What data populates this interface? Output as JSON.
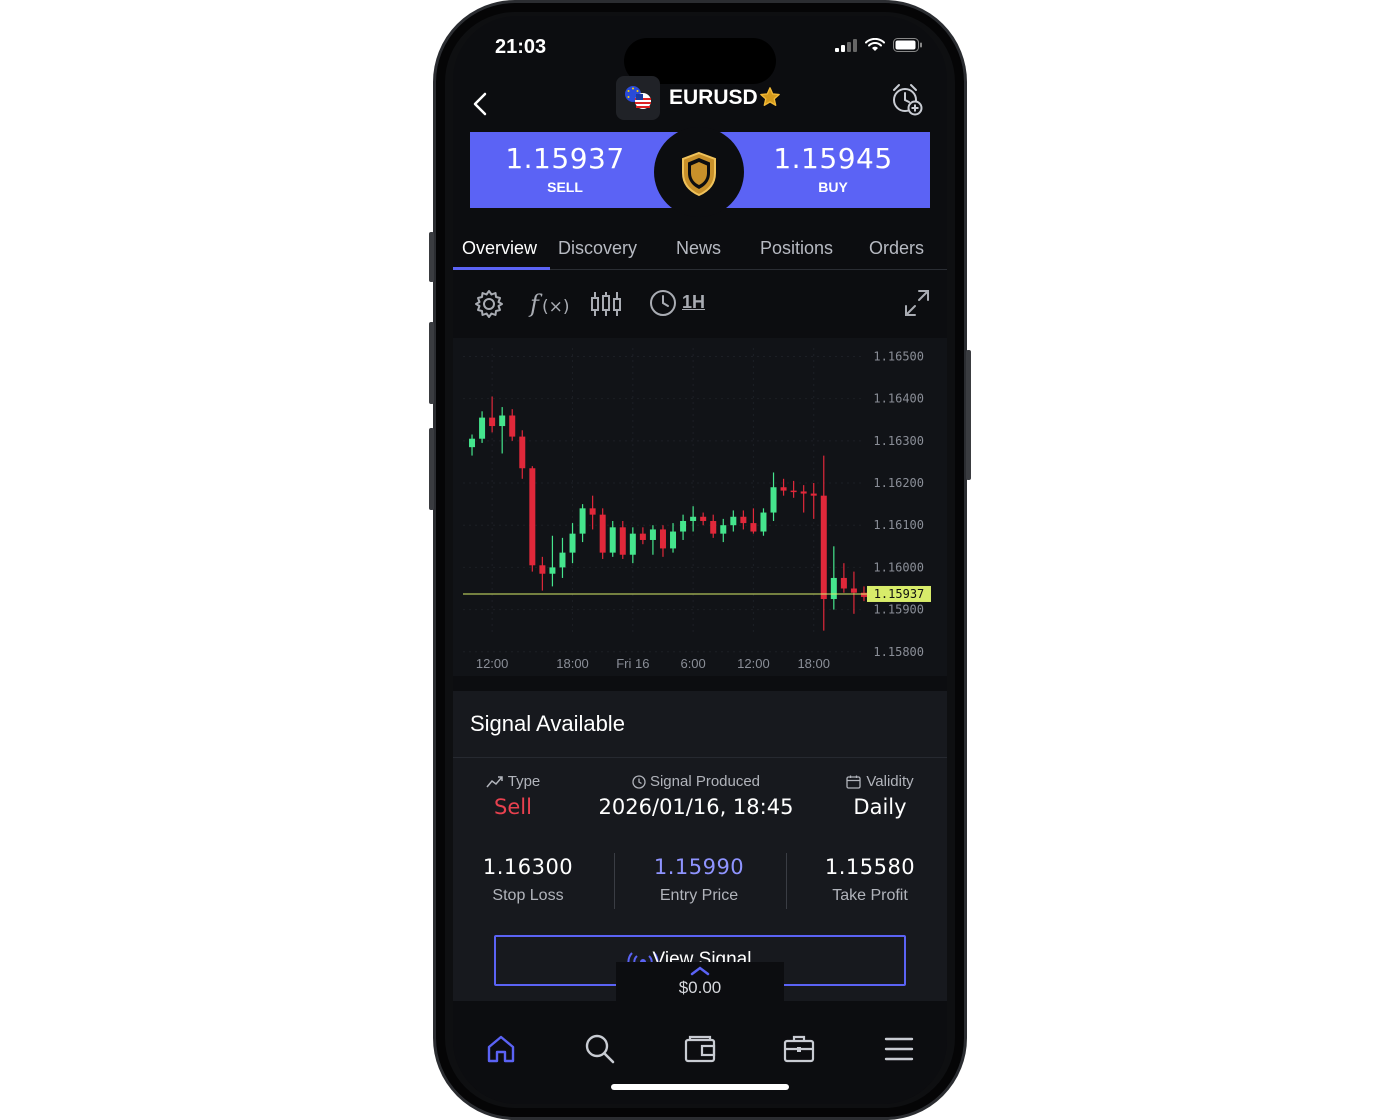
{
  "status_bar": {
    "time": "21:03"
  },
  "header": {
    "pair": "EURUSD"
  },
  "quote": {
    "sell_price": "1.15937",
    "sell_label": "SELL",
    "buy_price": "1.15945",
    "buy_label": "BUY"
  },
  "tabs": [
    {
      "label": "Overview",
      "active": true
    },
    {
      "label": "Discovery"
    },
    {
      "label": "News"
    },
    {
      "label": "Positions"
    },
    {
      "label": "Orders"
    }
  ],
  "toolbar": {
    "timeframe": "1H"
  },
  "chart_data": {
    "type": "candlestick",
    "y_ticks": [
      "1.16500",
      "1.16400",
      "1.16300",
      "1.16200",
      "1.16100",
      "1.16000",
      "1.15900",
      "1.15800"
    ],
    "x_ticks": [
      "12:00",
      "18:00",
      "Fri 16",
      "6:00",
      "12:00",
      "18:00"
    ],
    "ylim": [
      1.1579,
      1.1652
    ],
    "current_price": "1.15937",
    "colors": {
      "up": "#45e58d",
      "down": "#e0283a",
      "price_line": "#d8ec6a"
    },
    "candles": [
      {
        "o": 1.16285,
        "h": 1.16315,
        "l": 1.16265,
        "c": 1.16305
      },
      {
        "o": 1.16305,
        "h": 1.1637,
        "l": 1.16295,
        "c": 1.16355
      },
      {
        "o": 1.16355,
        "h": 1.16405,
        "l": 1.1632,
        "c": 1.16335
      },
      {
        "o": 1.16335,
        "h": 1.1638,
        "l": 1.1627,
        "c": 1.1636
      },
      {
        "o": 1.1636,
        "h": 1.16375,
        "l": 1.163,
        "c": 1.1631
      },
      {
        "o": 1.1631,
        "h": 1.16325,
        "l": 1.1621,
        "c": 1.16235
      },
      {
        "o": 1.16235,
        "h": 1.1624,
        "l": 1.1599,
        "c": 1.16005
      },
      {
        "o": 1.16005,
        "h": 1.16025,
        "l": 1.15945,
        "c": 1.15985
      },
      {
        "o": 1.15985,
        "h": 1.16075,
        "l": 1.15955,
        "c": 1.16
      },
      {
        "o": 1.16,
        "h": 1.1607,
        "l": 1.15975,
        "c": 1.16035
      },
      {
        "o": 1.16035,
        "h": 1.16105,
        "l": 1.1601,
        "c": 1.1608
      },
      {
        "o": 1.1608,
        "h": 1.1615,
        "l": 1.1606,
        "c": 1.1614
      },
      {
        "o": 1.1614,
        "h": 1.1617,
        "l": 1.1609,
        "c": 1.16125
      },
      {
        "o": 1.16125,
        "h": 1.1614,
        "l": 1.1602,
        "c": 1.16035
      },
      {
        "o": 1.16035,
        "h": 1.1611,
        "l": 1.16025,
        "c": 1.16095
      },
      {
        "o": 1.16095,
        "h": 1.1611,
        "l": 1.1602,
        "c": 1.1603
      },
      {
        "o": 1.1603,
        "h": 1.16095,
        "l": 1.1601,
        "c": 1.1608
      },
      {
        "o": 1.1608,
        "h": 1.16095,
        "l": 1.16055,
        "c": 1.16065
      },
      {
        "o": 1.16065,
        "h": 1.161,
        "l": 1.1603,
        "c": 1.1609
      },
      {
        "o": 1.1609,
        "h": 1.161,
        "l": 1.16025,
        "c": 1.16045
      },
      {
        "o": 1.16045,
        "h": 1.16105,
        "l": 1.16035,
        "c": 1.16085
      },
      {
        "o": 1.16085,
        "h": 1.16125,
        "l": 1.16065,
        "c": 1.1611
      },
      {
        "o": 1.1611,
        "h": 1.16145,
        "l": 1.16085,
        "c": 1.1612
      },
      {
        "o": 1.1612,
        "h": 1.1613,
        "l": 1.161,
        "c": 1.1611
      },
      {
        "o": 1.1611,
        "h": 1.16125,
        "l": 1.1607,
        "c": 1.1608
      },
      {
        "o": 1.1608,
        "h": 1.16115,
        "l": 1.1606,
        "c": 1.161
      },
      {
        "o": 1.161,
        "h": 1.16135,
        "l": 1.16085,
        "c": 1.1612
      },
      {
        "o": 1.1612,
        "h": 1.16135,
        "l": 1.1609,
        "c": 1.16105
      },
      {
        "o": 1.16105,
        "h": 1.1614,
        "l": 1.1608,
        "c": 1.16085
      },
      {
        "o": 1.16085,
        "h": 1.1614,
        "l": 1.16075,
        "c": 1.1613
      },
      {
        "o": 1.1613,
        "h": 1.16225,
        "l": 1.1611,
        "c": 1.1619
      },
      {
        "o": 1.1619,
        "h": 1.1621,
        "l": 1.1617,
        "c": 1.16182
      },
      {
        "o": 1.16182,
        "h": 1.16205,
        "l": 1.16165,
        "c": 1.1618
      },
      {
        "o": 1.1618,
        "h": 1.16195,
        "l": 1.1613,
        "c": 1.16175
      },
      {
        "o": 1.16175,
        "h": 1.162,
        "l": 1.16115,
        "c": 1.1617
      },
      {
        "o": 1.1617,
        "h": 1.16265,
        "l": 1.1585,
        "c": 1.15925
      },
      {
        "o": 1.15925,
        "h": 1.1605,
        "l": 1.159,
        "c": 1.15975
      },
      {
        "o": 1.15975,
        "h": 1.1601,
        "l": 1.1594,
        "c": 1.1595
      },
      {
        "o": 1.1595,
        "h": 1.1599,
        "l": 1.1589,
        "c": 1.1594
      },
      {
        "o": 1.1594,
        "h": 1.15955,
        "l": 1.1592,
        "c": 1.1593
      }
    ]
  },
  "signal": {
    "title": "Signal Available",
    "type_label": "Type",
    "type_value": "Sell",
    "produced_label": "Signal Produced",
    "produced_value": "2026/01/16, 18:45",
    "validity_label": "Validity",
    "validity_value": "Daily",
    "stop_loss_value": "1.16300",
    "stop_loss_label": "Stop Loss",
    "entry_value": "1.15990",
    "entry_label": "Entry Price",
    "take_profit_value": "1.15580",
    "take_profit_label": "Take Profit",
    "view_button": "View Signal",
    "colors": {
      "sell": "#e8414f",
      "entry": "#8f94ff"
    }
  },
  "balance": {
    "amount": "$0.00"
  },
  "nav": {
    "items": [
      {
        "icon": "home-icon",
        "active": true
      },
      {
        "icon": "search-icon"
      },
      {
        "icon": "wallet-icon"
      },
      {
        "icon": "briefcase-icon"
      },
      {
        "icon": "menu-icon"
      }
    ]
  },
  "accent": "#5b63f5"
}
